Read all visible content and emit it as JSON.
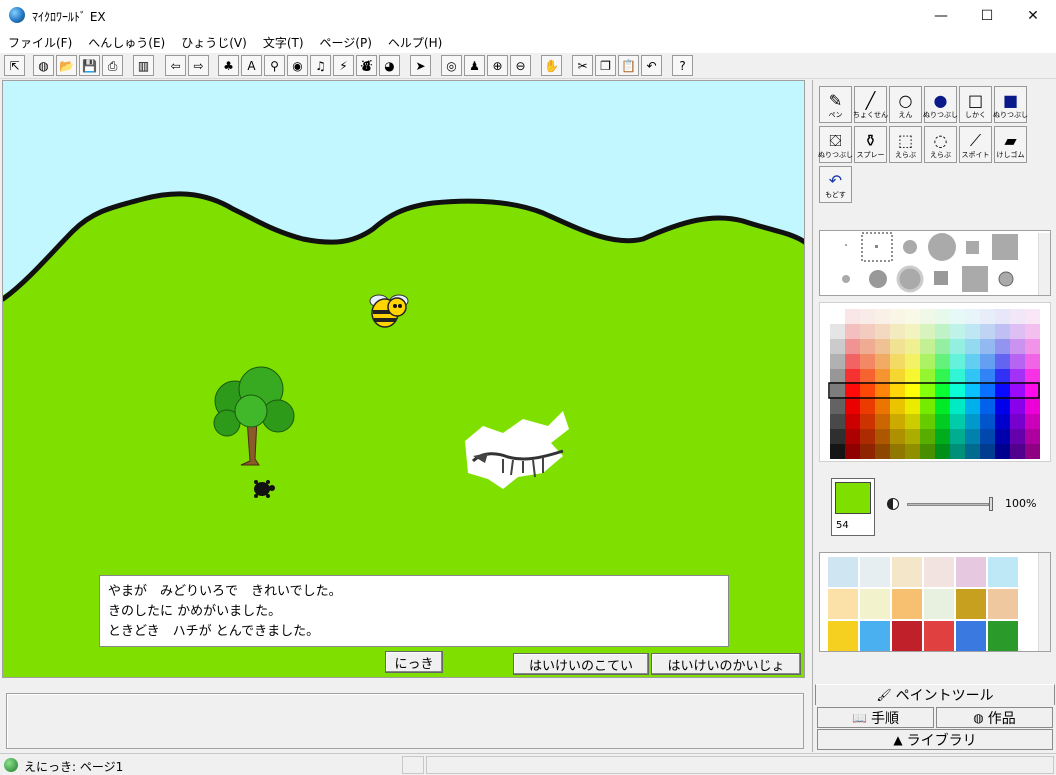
{
  "window": {
    "title": "ﾏｲｸﾛﾜｰﾙﾄﾞ EX",
    "minimize": "—",
    "maximize": "☐",
    "close": "✕"
  },
  "menu": [
    "ファイル(F)",
    "へんしゅう(E)",
    "ひょうじ(V)",
    "文字(T)",
    "ページ(P)",
    "ヘルプ(H)"
  ],
  "toolbar": [
    {
      "icon": "pointer-icon",
      "glyph": "⇱"
    },
    {
      "icon": "world-icon",
      "glyph": "◍"
    },
    {
      "icon": "open-folder-icon",
      "glyph": "📂"
    },
    {
      "icon": "save-icon",
      "glyph": "💾"
    },
    {
      "icon": "print-icon",
      "glyph": "⎙"
    },
    {
      "icon": "layout-icon",
      "glyph": "▥"
    },
    {
      "icon": "arrow-left-icon",
      "glyph": "⇦"
    },
    {
      "icon": "arrow-right-icon",
      "glyph": "⇨"
    },
    {
      "icon": "character-icon",
      "glyph": "♣"
    },
    {
      "icon": "text-a-icon",
      "glyph": "A"
    },
    {
      "icon": "figure-icon",
      "glyph": "⚲"
    },
    {
      "icon": "object-icon",
      "glyph": "◉"
    },
    {
      "icon": "music-note-icon",
      "glyph": "♫"
    },
    {
      "icon": "magic-wand-icon",
      "glyph": "⚡"
    },
    {
      "icon": "movie-camera-icon",
      "glyph": "⛇"
    },
    {
      "icon": "globe-person-icon",
      "glyph": "◕"
    },
    {
      "icon": "cursor-arrow-icon",
      "glyph": "➤"
    },
    {
      "icon": "eye-icon",
      "glyph": "◎"
    },
    {
      "icon": "stamp-icon",
      "glyph": "♟"
    },
    {
      "icon": "zoom-in-icon",
      "glyph": "⊕"
    },
    {
      "icon": "zoom-out-icon",
      "glyph": "⊖"
    },
    {
      "icon": "hand-stop-icon",
      "glyph": "✋"
    },
    {
      "icon": "scissors-icon",
      "glyph": "✂"
    },
    {
      "icon": "copy-icon",
      "glyph": "❐"
    },
    {
      "icon": "paste-icon",
      "glyph": "📋"
    },
    {
      "icon": "undo-icon",
      "glyph": "↶"
    },
    {
      "icon": "help-question-icon",
      "glyph": "?"
    }
  ],
  "canvas": {
    "sky_color": "#c2f7ff",
    "grass_color": "#7fe000",
    "text_lines": [
      "やまが　みどりいろで　きれいでした。",
      "きのしたに かめがいました。",
      "ときどき　ハチが とんできました。"
    ],
    "buttons": {
      "diary": "にっき",
      "bg_fix": "はいけいのこてい",
      "bg_release": "はいけいのかいじょ"
    }
  },
  "paint_tools": [
    {
      "name": "pen",
      "label": "ペン",
      "glyph": "✎"
    },
    {
      "name": "line",
      "label": "ちょくせん",
      "glyph": "╱"
    },
    {
      "name": "circle",
      "label": "えん",
      "glyph": "○"
    },
    {
      "name": "filled-circle",
      "label": "ぬりつぶし",
      "glyph": "●"
    },
    {
      "name": "rect",
      "label": "しかく",
      "glyph": "□"
    },
    {
      "name": "filled-rect",
      "label": "ぬりつぶし",
      "glyph": "■"
    },
    {
      "name": "fill-bucket",
      "label": "ぬりつぶし",
      "glyph": "⛋"
    },
    {
      "name": "spray",
      "label": "スプレー",
      "glyph": "⚱"
    },
    {
      "name": "select-rect",
      "label": "えらぶ",
      "glyph": "⬚"
    },
    {
      "name": "lasso",
      "label": "えらぶ",
      "glyph": "◌"
    },
    {
      "name": "dropper",
      "label": "スポイト",
      "glyph": "⟋"
    },
    {
      "name": "eraser",
      "label": "けしゴム",
      "glyph": "▰"
    },
    {
      "name": "undo",
      "label": "もどす",
      "glyph": "↶"
    }
  ],
  "current_color": {
    "hex": "#7fe000",
    "number": "54"
  },
  "opacity_text": "100%",
  "panel_tabs": {
    "paint": "ペイントツール",
    "steps": "手順",
    "works": "作品",
    "library": "ライブラリ"
  },
  "status": {
    "text": "えにっき: ページ1"
  }
}
